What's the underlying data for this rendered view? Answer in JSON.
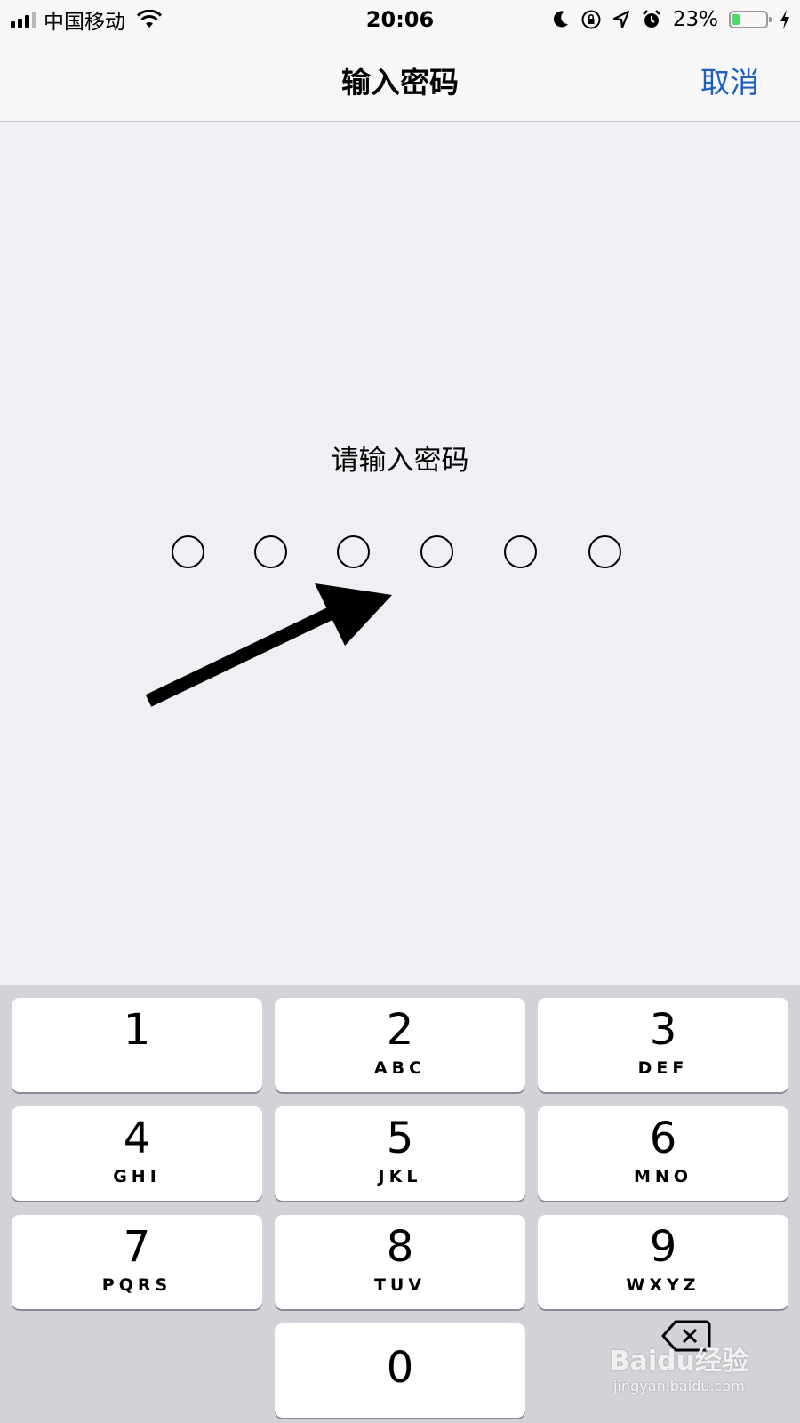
{
  "status_bar": {
    "carrier": "中国移动",
    "time": "20:06",
    "battery_percent": "23%",
    "battery_level": 0.23,
    "icons": [
      "signal-icon",
      "wifi-icon",
      "moon-icon",
      "rotation-lock-icon",
      "location-icon",
      "alarm-icon",
      "battery-icon",
      "charging-bolt-icon"
    ]
  },
  "nav": {
    "title": "输入密码",
    "cancel_label": "取消",
    "accent_color": "#1f5fc1"
  },
  "prompt": "请输入密码",
  "passcode": {
    "length": 6,
    "entered": 0
  },
  "annotation": {
    "type": "arrow",
    "color": "#000000"
  },
  "keypad": {
    "keys": [
      {
        "num": "1",
        "letters": ""
      },
      {
        "num": "2",
        "letters": "ABC"
      },
      {
        "num": "3",
        "letters": "DEF"
      },
      {
        "num": "4",
        "letters": "GHI"
      },
      {
        "num": "5",
        "letters": "JKL"
      },
      {
        "num": "6",
        "letters": "MNO"
      },
      {
        "num": "7",
        "letters": "PQRS"
      },
      {
        "num": "8",
        "letters": "TUV"
      },
      {
        "num": "9",
        "letters": "WXYZ"
      },
      {
        "num": "0",
        "letters": ""
      }
    ],
    "delete_icon": "delete-backspace-icon"
  },
  "watermark": {
    "main": "Baidu经验",
    "sub": "jingyan.baidu.com"
  }
}
